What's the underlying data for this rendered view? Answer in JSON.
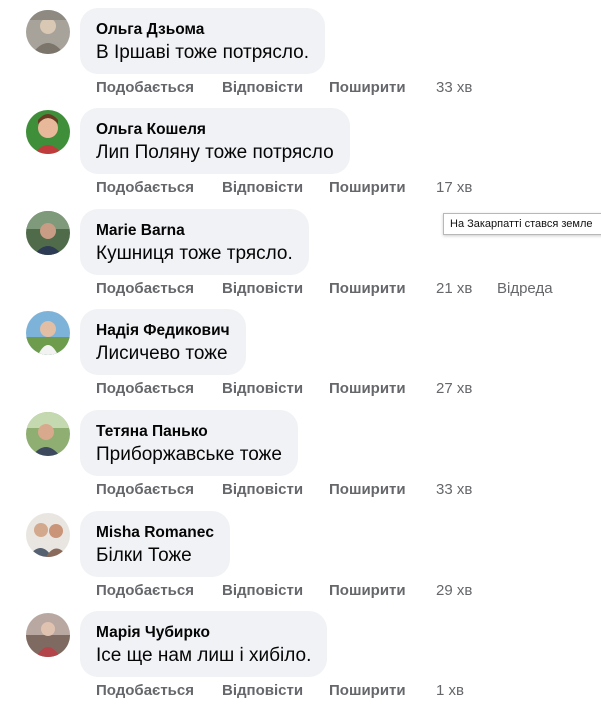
{
  "actions": {
    "like": "Подобається",
    "reply": "Відповісти",
    "share": "Поширити"
  },
  "tooltip_text": "На Закарпатті стався земле",
  "comments": [
    {
      "author": "Ольга Дзьома",
      "text": "В Іршаві тоже потрясло.",
      "time": "33 хв"
    },
    {
      "author": "Ольга Кошеля",
      "text": "Лип Поляну тоже потрясло",
      "time": "17 хв"
    },
    {
      "author": "Marie Barna",
      "text": "Кушниця тоже трясло.",
      "time": "21 хв",
      "edited": "Відреда"
    },
    {
      "author": "Надія Федикович",
      "text": "Лисичево тоже",
      "time": "27 хв"
    },
    {
      "author": "Тетяна Панько",
      "text": "Приборжавське тоже",
      "time": "33 хв"
    },
    {
      "author": "Misha Romanec",
      "text": "Білки Тоже",
      "time": "29 хв"
    },
    {
      "author": "Марія Чубирко",
      "text": "Ісе ще нам лиш і хибіло.",
      "time": "1 хв"
    }
  ]
}
